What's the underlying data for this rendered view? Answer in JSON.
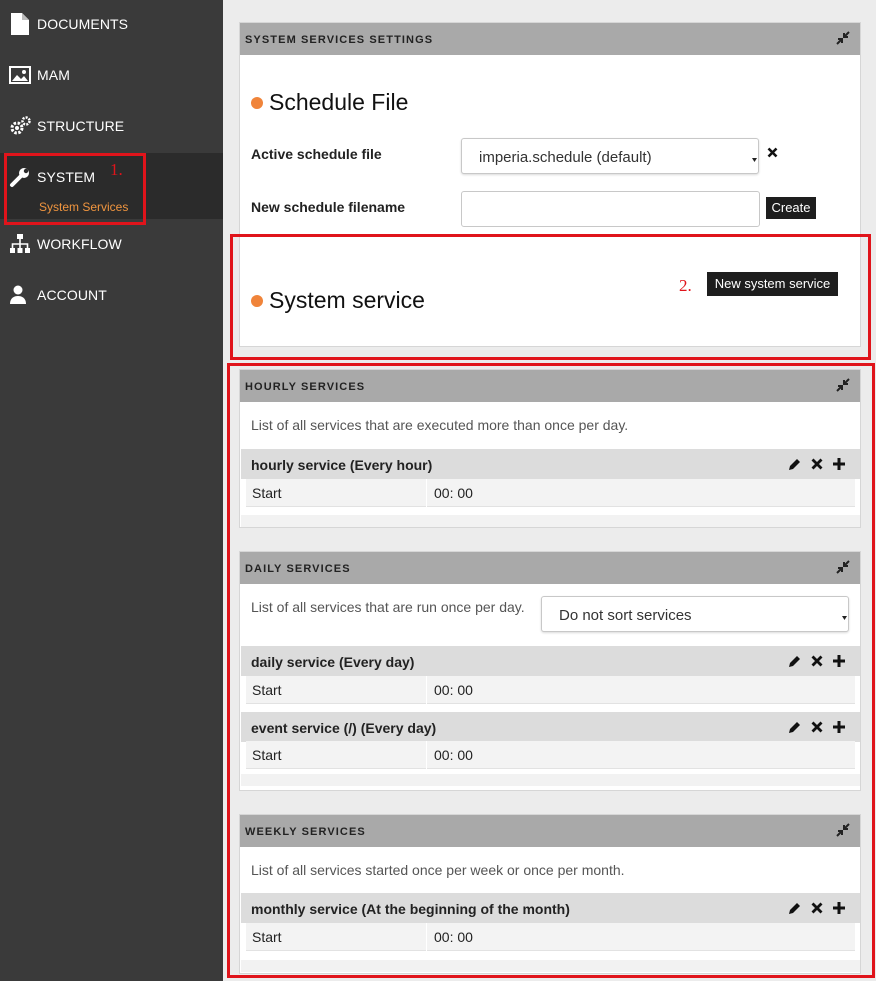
{
  "sidebar": {
    "items": [
      {
        "label": "DOCUMENTS",
        "icon": "document-icon"
      },
      {
        "label": "MAM",
        "icon": "image-icon"
      },
      {
        "label": "STRUCTURE",
        "icon": "gears-icon"
      },
      {
        "label": "SYSTEM",
        "icon": "wrench-icon",
        "sub": "System Services"
      },
      {
        "label": "WORKFLOW",
        "icon": "sitemap-icon"
      },
      {
        "label": "ACCOUNT",
        "icon": "user-icon"
      }
    ]
  },
  "annotations": {
    "one": "1.",
    "two": "2."
  },
  "settings": {
    "title": "SYSTEM SERVICES SETTINGS",
    "schedule_heading": "Schedule File",
    "active_label": "Active schedule file",
    "active_value": "imperia.schedule (default)",
    "new_label": "New schedule filename",
    "new_value": "",
    "create_label": "Create",
    "service_heading": "System service",
    "new_service_label": "New system service"
  },
  "hourly": {
    "title": "HOURLY SERVICES",
    "desc": "List of all services that are executed more than once per day.",
    "services": [
      {
        "name": "hourly service (Every hour)",
        "key": "Start",
        "value": "00: 00"
      }
    ]
  },
  "daily": {
    "title": "DAILY SERVICES",
    "desc": "List of all services that are run once per day.",
    "sort_value": "Do not sort services",
    "services": [
      {
        "name": "daily service (Every day)",
        "key": "Start",
        "value": "00: 00"
      },
      {
        "name": "event service (/) (Every day)",
        "key": "Start",
        "value": "00: 00"
      }
    ]
  },
  "weekly": {
    "title": "WEEKLY SERVICES",
    "desc": "List of all services started once per week or once per month.",
    "services": [
      {
        "name": "monthly service (At the beginning of the month)",
        "key": "Start",
        "value": "00: 00"
      }
    ]
  },
  "colors": {
    "sidebar_bg": "#3a3a3a",
    "accent_orange": "#f0843a",
    "annotation_red": "#e0141b",
    "panel_header": "#a9a9a9"
  }
}
